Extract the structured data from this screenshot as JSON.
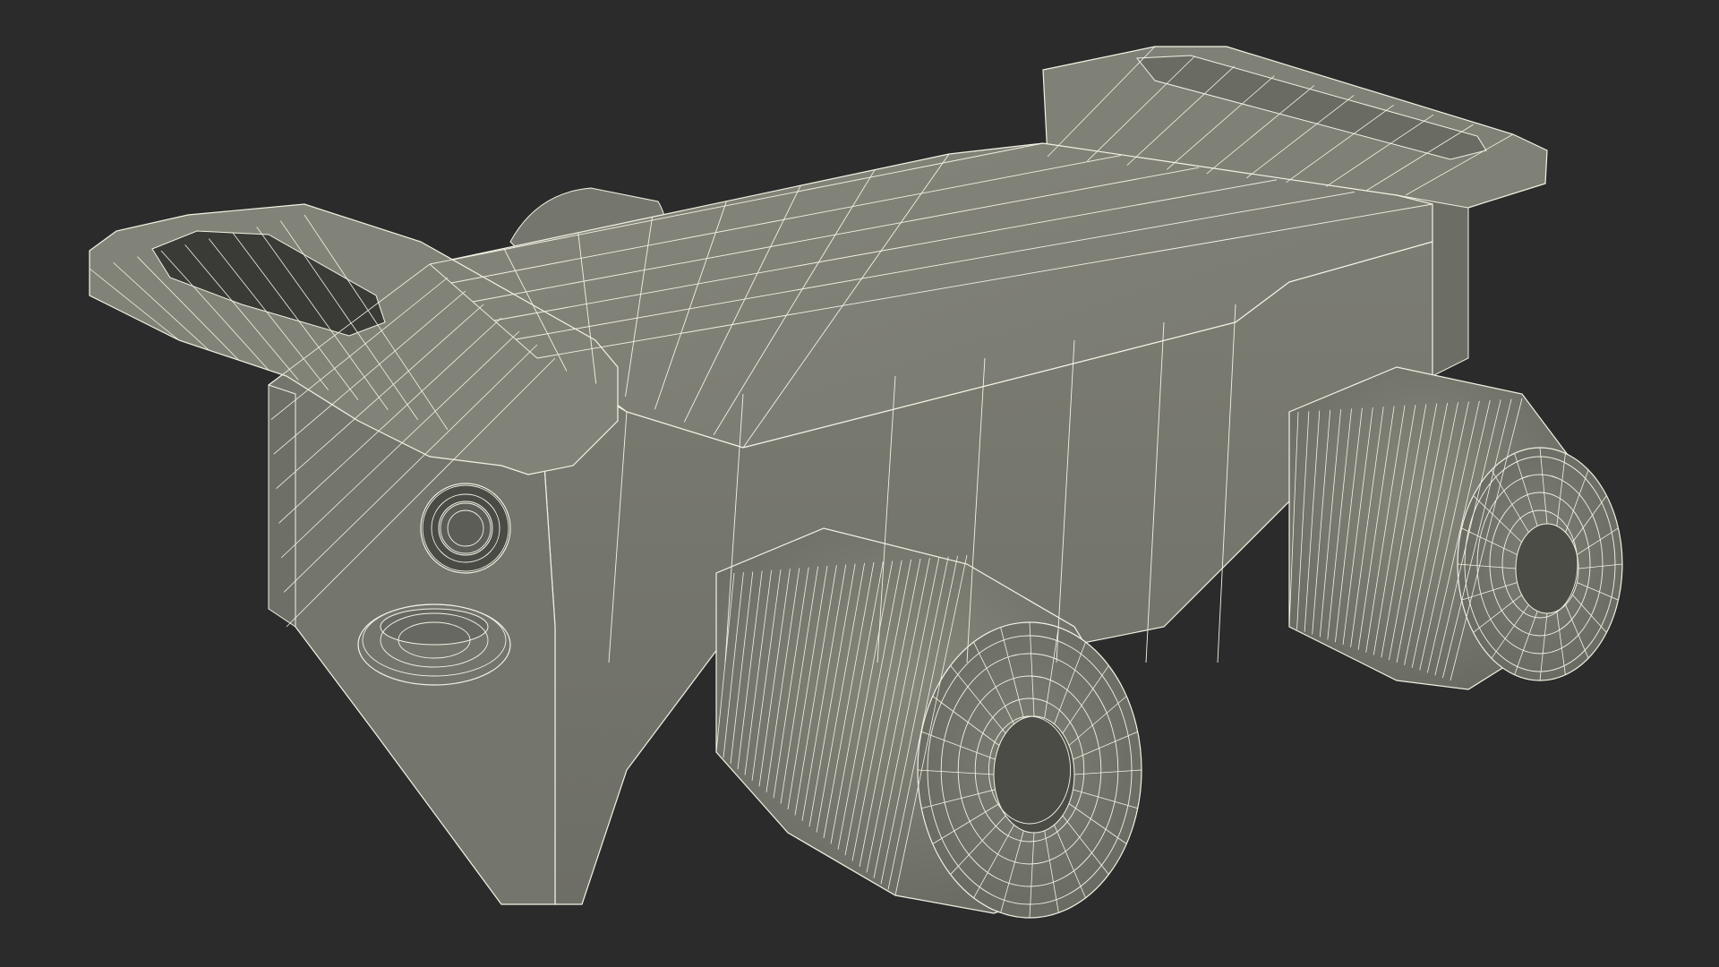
{
  "scene": {
    "subject": "wireframe-mesh-3d-model",
    "background_color": "#2b2b2b",
    "surface_color": "#7d7e73",
    "surface_shadow_color": "#5f6058",
    "surface_highlight_color": "#8e8f84",
    "wire_color": "#f4f2e4"
  }
}
